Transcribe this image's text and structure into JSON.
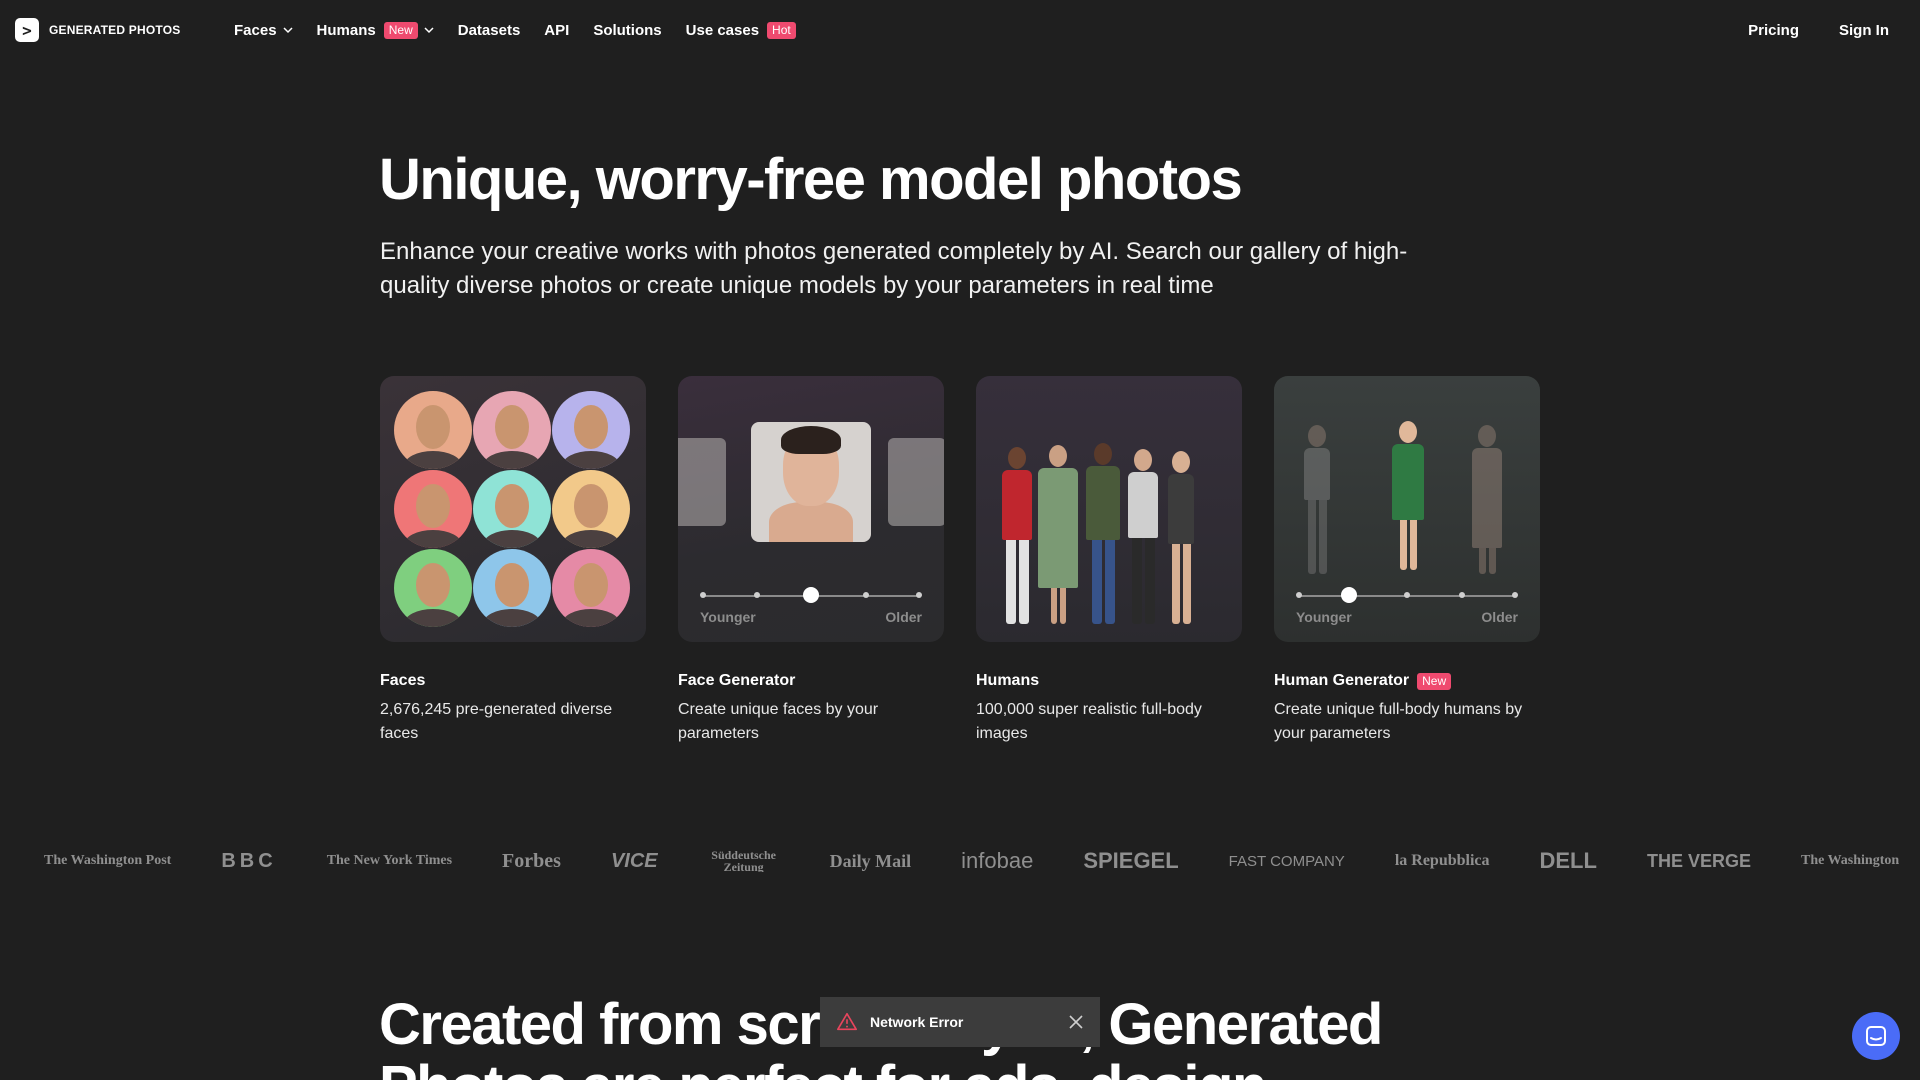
{
  "brand": {
    "name": "GENERATED PHOTOS",
    "logo_glyph": ">"
  },
  "nav": {
    "items": [
      {
        "label": "Faces",
        "dropdown": true
      },
      {
        "label": "Humans",
        "badge": "New",
        "dropdown": true
      },
      {
        "label": "Datasets"
      },
      {
        "label": "API"
      },
      {
        "label": "Solutions"
      },
      {
        "label": "Use cases",
        "badge": "Hot"
      }
    ],
    "pricing": "Pricing",
    "sign_in": "Sign In"
  },
  "hero": {
    "title": "Unique, worry-free model photos",
    "subtitle": "Enhance your creative works with photos generated completely by AI. Search our gallery of high-quality diverse photos or create unique models by your parameters in real time"
  },
  "cards": [
    {
      "title": "Faces",
      "description": "2,676,245 pre-generated diverse faces"
    },
    {
      "title": "Face Generator",
      "description": "Create unique faces by your parameters",
      "slider_min_label": "Younger",
      "slider_max_label": "Older"
    },
    {
      "title": "Humans",
      "description": "100,000 super realistic full-body images"
    },
    {
      "title": "Human Generator",
      "badge": "New",
      "description": "Create unique full-body humans by your parameters",
      "slider_min_label": "Younger",
      "slider_max_label": "Older"
    }
  ],
  "press_logos": [
    "The Washington Post",
    "BBC",
    "The New York Times",
    "Forbes",
    "VICE",
    "Süddeutsche Zeitung",
    "Daily Mail",
    "infobae",
    "SPIEGEL",
    "FAST COMPANY",
    "la Repubblica",
    "DELL",
    "THE VERGE",
    "The Washington"
  ],
  "section2": {
    "title": "Created from scratch by AI, Generated Photos are perfect for ads, design"
  },
  "toast": {
    "message": "Network Error",
    "icon": "warning-icon"
  },
  "colors": {
    "background": "#1f1f1f",
    "badge": "#ef4a6f",
    "chat": "#4a6cf7",
    "toast_bg": "#3c3c3c"
  }
}
